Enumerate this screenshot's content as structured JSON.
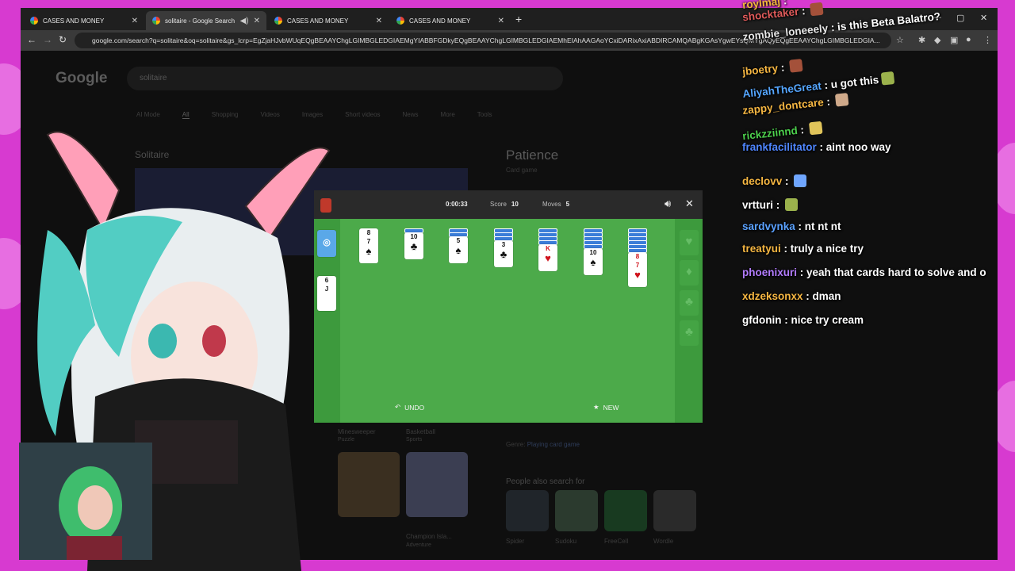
{
  "tabs": [
    {
      "label": "CASES AND MONEY",
      "active": false
    },
    {
      "label": "solitaire - Google Search",
      "active": true
    },
    {
      "label": "CASES AND MONEY",
      "active": false
    },
    {
      "label": "CASES AND MONEY",
      "active": false
    }
  ],
  "address": "google.com/search?q=solitaire&oq=solitaire&gs_lcrp=EgZjaHJvbWUqEQgBEAAYChgLGIMBGLEDGIAEMgYIABBFGDkyEQgBEAAYChgLGIMBGLEDGIAEMhEIAhAAGAoYCxiDARixAxiABDIRCAMQABgKGAsYgwEYsQMYgAQyEQgEEAAYChgLGIMBGLEDGIA...",
  "google": {
    "logo": "Google",
    "query": "solitaire",
    "tabs": [
      "AI Mode",
      "All",
      "Shopping",
      "Videos",
      "Images",
      "Short videos",
      "News",
      "More",
      "Tools"
    ],
    "left_title": "Solitaire",
    "right_title": "Patience",
    "right_subtitle": "Card game",
    "genre_label": "Genre:",
    "genre_value": "Playing card game",
    "people_also": "People also search for",
    "related": [
      "Spider",
      "Sudoku",
      "FreeCell",
      "Wordle"
    ],
    "thumb_caps": [
      "Minesweeper",
      "Puzzle",
      "Basketball",
      "Sports",
      "Champion Isla...",
      "Adventure"
    ]
  },
  "solitaire": {
    "timer": "0:00:33",
    "score_label": "Score",
    "score": "10",
    "moves_label": "Moves",
    "moves": "5",
    "undo": "UNDO",
    "new": "NEW",
    "waste": [
      "6",
      "J"
    ],
    "tableau": [
      {
        "backs": 0,
        "rank": "8",
        "rank2": "7",
        "suit": "♠",
        "color": "black"
      },
      {
        "backs": 1,
        "rank": "10",
        "suit": "♣",
        "color": "black"
      },
      {
        "backs": 2,
        "rank": "5",
        "suit": "♠",
        "color": "black"
      },
      {
        "backs": 3,
        "rank": "3",
        "suit": "♣",
        "color": "black"
      },
      {
        "backs": 4,
        "rank": "K",
        "suit": "♥",
        "color": "red"
      },
      {
        "backs": 5,
        "rank": "10",
        "suit": "♠",
        "color": "black"
      },
      {
        "backs": 6,
        "rank": "8",
        "rank2": "7",
        "suit": "♥",
        "color": "red"
      }
    ],
    "foundations": [
      "♥",
      "♦",
      "♣",
      "♣"
    ]
  },
  "chat": [
    {
      "user": "roylmaj",
      "text": "",
      "color": "#f6b73c"
    },
    {
      "user": "shocktaker",
      "text": "",
      "color": "#e05a5a",
      "emote": "#a4513a"
    },
    {
      "user": "zombie_loneeely",
      "text": "is this Beta Balatro?",
      "color": "#e7e7e7"
    },
    {
      "user": "jboetry",
      "text": "",
      "color": "#f5b642",
      "emote": "#a4513a"
    },
    {
      "user": "AliyahTheGreat",
      "text": "u got this",
      "color": "#55a6ff",
      "emote": "#9bb24c"
    },
    {
      "user": "zappy_dontcare",
      "text": "",
      "color": "#f5b642",
      "emote": "#cfa98a"
    },
    {
      "user": "rickzziinnd",
      "text": "",
      "color": "#4ccf4c",
      "emote": "#e0c45a"
    },
    {
      "user": "frankfacilitator",
      "text": "aint noo way",
      "color": "#4f86ff"
    },
    {
      "user": "declovv",
      "text": "",
      "color": "#f5b642",
      "emote": "#6fa6ff"
    },
    {
      "user": "vrtturi",
      "text": "",
      "color": "#ffffff",
      "emote": "#9bb24c"
    },
    {
      "user": "sardvynka",
      "text": "nt nt nt",
      "color": "#5aa1ff"
    },
    {
      "user": "treatyui",
      "text": "truly a nice try",
      "color": "#f5b642"
    },
    {
      "user": "phoenixuri",
      "text": "yeah that cards hard to solve and o",
      "color": "#b27cff"
    },
    {
      "user": "xdzeksonxx",
      "text": "dman",
      "color": "#f5b642"
    },
    {
      "user": "gfdonin",
      "text": "nice try cream",
      "color": "#ffffff"
    }
  ],
  "colors": {
    "frame": "#d73ad0",
    "felt": "#4caa4a",
    "browser": "#0c0c0c"
  }
}
